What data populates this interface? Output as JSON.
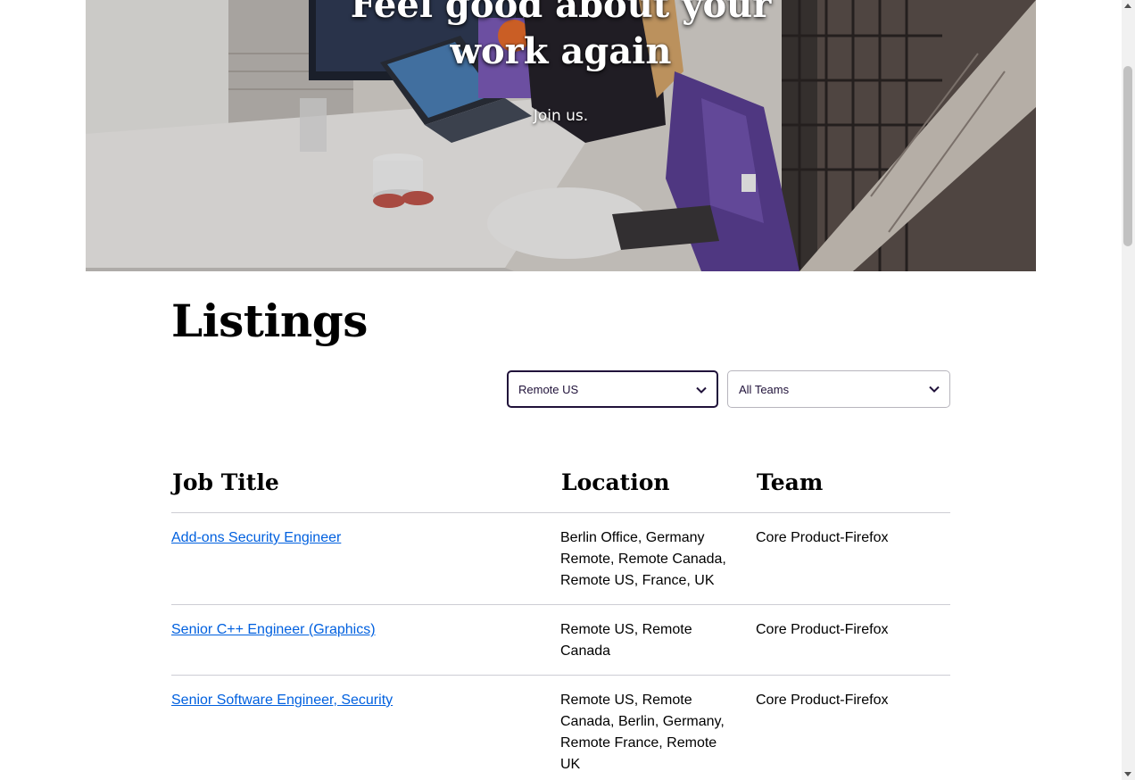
{
  "hero": {
    "heading": "Feel good about your work again",
    "subheading": "Join us."
  },
  "listings": {
    "title": "Listings",
    "filters": {
      "location": {
        "selected": "Remote US"
      },
      "team": {
        "selected": "All Teams"
      }
    },
    "columns": [
      "Job Title",
      "Location",
      "Team"
    ],
    "rows": [
      {
        "title": "Add-ons Security Engineer",
        "location": "Berlin Office, Germany Remote, Remote Canada, Remote US, France, UK",
        "team": "Core Product-Firefox"
      },
      {
        "title": "Senior C++ Engineer (Graphics)",
        "location": "Remote US, Remote Canada",
        "team": "Core Product-Firefox"
      },
      {
        "title": "Senior Software Engineer, Security",
        "location": "Remote US, Remote Canada, Berlin, Germany, Remote France, Remote UK",
        "team": "Core Product-Firefox"
      }
    ]
  },
  "colors": {
    "link": "#0060df",
    "text": "#000000",
    "divider": "#cdcdd4"
  },
  "icons": {
    "select_chevron": "chevron-down-icon"
  }
}
